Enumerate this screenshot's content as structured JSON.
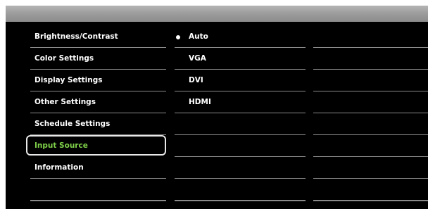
{
  "menu": {
    "items": [
      {
        "label": "Brightness/Contrast"
      },
      {
        "label": "Color Settings"
      },
      {
        "label": "Display Settings"
      },
      {
        "label": "Other Settings"
      },
      {
        "label": "Schedule Settings"
      },
      {
        "label": "Input Source"
      },
      {
        "label": "Information"
      }
    ],
    "selected": "Input Source"
  },
  "submenu": {
    "options": [
      {
        "label": "Auto"
      },
      {
        "label": "VGA"
      },
      {
        "label": "DVI"
      },
      {
        "label": "HDMI"
      }
    ],
    "current": "Auto"
  },
  "colors": {
    "panel_bg": "#000000",
    "highlight_text": "#7fd04a",
    "frame": "#e8e8e8",
    "divider": "#8a8a8a"
  }
}
